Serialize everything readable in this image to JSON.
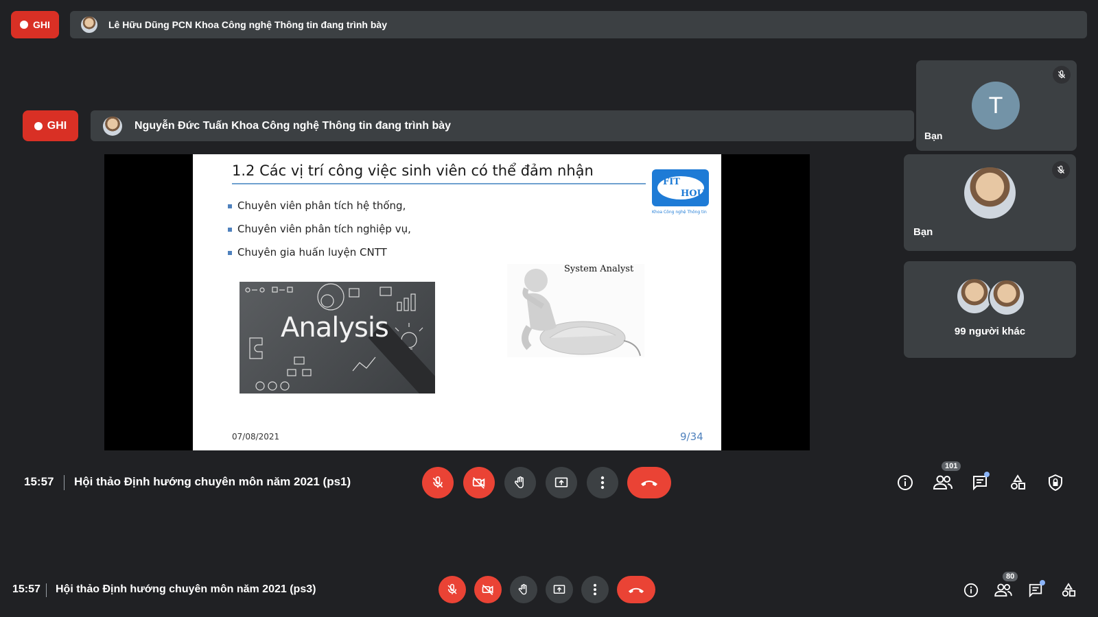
{
  "top_bar": {
    "record_label": "GHI",
    "presenter_text": "Lê Hữu Dũng PCN Khoa Công nghệ Thông tin đang trình bày"
  },
  "inner_bar": {
    "record_label": "GHI",
    "presenter_text": "Nguyễn Đức Tuấn Khoa Công nghệ Thông tin đang trình bày"
  },
  "slide": {
    "title": "1.2 Các vị trí công việc sinh viên có thể đảm nhận",
    "bullets": [
      "Chuyên viên phân tích hệ thống,",
      "Chuyên viên phân tích nghiệp vụ,",
      "Chuyên gia huấn luyện CNTT"
    ],
    "image_word": "Analysis",
    "figure_caption": "System Analyst",
    "logo_line1": "FIT",
    "logo_line2": "HOU",
    "logo_caption": "Khoa Công nghệ Thông tin",
    "date": "07/08/2021",
    "page": "9/34"
  },
  "participants": {
    "tile1": {
      "initial": "T",
      "name": "Bạn"
    },
    "tile2": {
      "name": "Bạn"
    },
    "tile3": {
      "others": "99 người khác"
    }
  },
  "inner_controls": {
    "time": "15:57",
    "meeting_title": "Hội thảo Định hướng chuyên môn năm 2021 (ps1)",
    "people_count": "101"
  },
  "outer_controls": {
    "time": "15:57",
    "meeting_title": "Hội thảo Định hướng chuyên môn năm 2021 (ps3)",
    "people_count": "80"
  },
  "icons": [
    "record-dot-icon",
    "mic-off-icon",
    "camera-off-icon",
    "raise-hand-icon",
    "present-screen-icon",
    "more-options-icon",
    "end-call-icon",
    "info-icon",
    "people-icon",
    "chat-icon",
    "activities-icon",
    "host-controls-icon"
  ],
  "colors": {
    "background": "#202124",
    "surface": "#3c4043",
    "danger": "#ea4335",
    "record": "#d93025",
    "accent": "#8ab4f8",
    "avatar_T": "#7393a7"
  }
}
